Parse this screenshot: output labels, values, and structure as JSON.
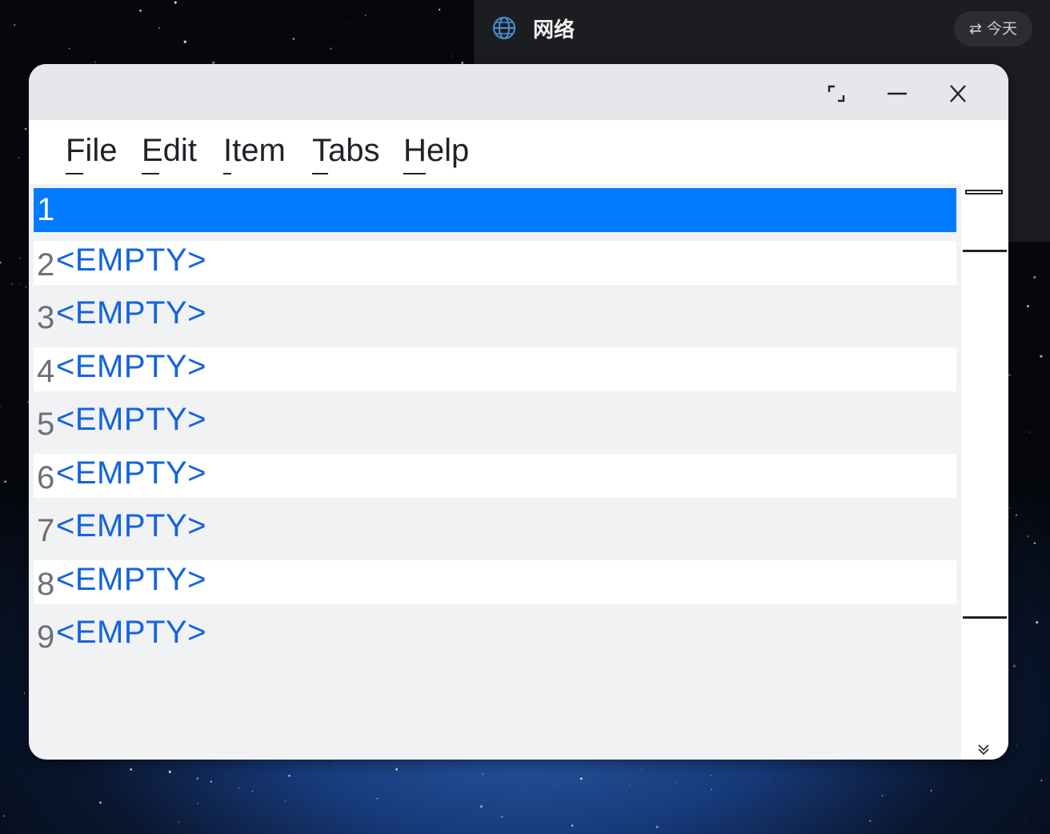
{
  "notification": {
    "title": "网络",
    "icon": "globe-icon",
    "today_button": "今天",
    "today_icon": "swap-arrows-icon"
  },
  "window": {
    "controls": [
      "maximize-icon",
      "minimize-icon",
      "close-icon"
    ]
  },
  "menu": [
    {
      "label": "File",
      "name": "menu-file"
    },
    {
      "label": "Edit",
      "name": "menu-edit"
    },
    {
      "label": "Item",
      "name": "menu-item"
    },
    {
      "label": "Tabs",
      "name": "menu-tabs"
    },
    {
      "label": "Help",
      "name": "menu-help"
    }
  ],
  "rows": [
    {
      "num": "1",
      "value": "",
      "selected": true
    },
    {
      "num": "2",
      "value": "<EMPTY>"
    },
    {
      "num": "3",
      "value": "<EMPTY>"
    },
    {
      "num": "4",
      "value": "<EMPTY>"
    },
    {
      "num": "5",
      "value": "<EMPTY>"
    },
    {
      "num": "6",
      "value": "<EMPTY>"
    },
    {
      "num": "7",
      "value": "<EMPTY>"
    },
    {
      "num": "8",
      "value": "<EMPTY>"
    },
    {
      "num": "9",
      "value": "<EMPTY>"
    }
  ],
  "colors": {
    "selection": "#007bff",
    "empty_text": "#1463e0",
    "row_alt": "#ffffff",
    "row_base": "#f1f2f4"
  }
}
